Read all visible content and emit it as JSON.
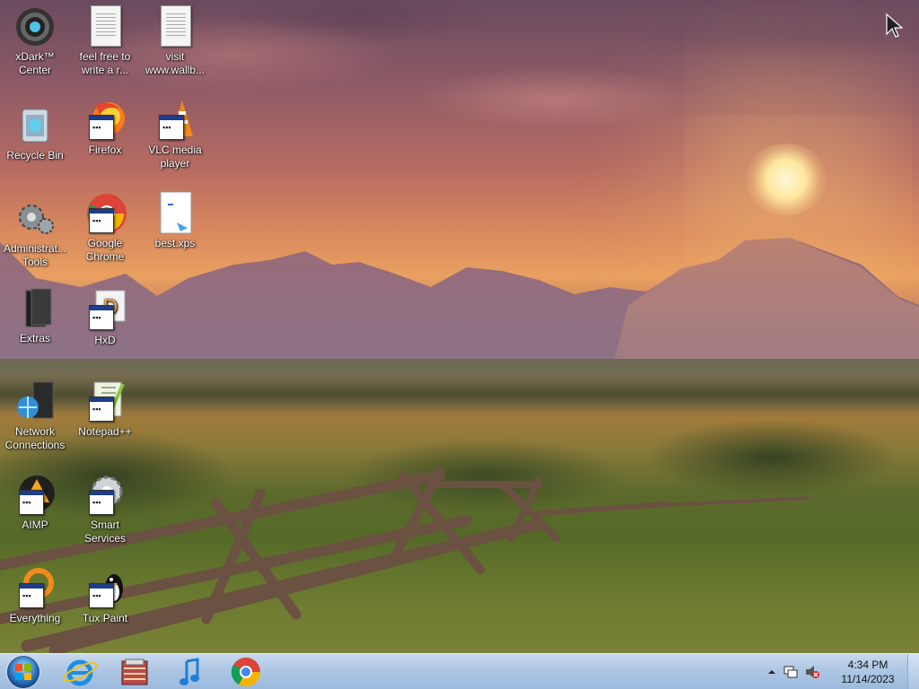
{
  "desktop": {
    "icons": [
      {
        "label": "xDark™ Center"
      },
      {
        "label": "feel free to write a r..."
      },
      {
        "label": "visit www.wallb..."
      },
      {
        "label": "Recycle Bin"
      },
      {
        "label": "Firefox"
      },
      {
        "label": "VLC media player"
      },
      {
        "label": "Administrat... Tools"
      },
      {
        "label": "Google Chrome"
      },
      {
        "label": "best.xps"
      },
      {
        "label": "Extras"
      },
      {
        "label": "HxD"
      },
      {
        "label": "Network Connections"
      },
      {
        "label": "Notepad++"
      },
      {
        "label": "AIMP"
      },
      {
        "label": "Smart Services"
      },
      {
        "label": "Everything"
      },
      {
        "label": "Tux Paint"
      }
    ]
  },
  "taskbar": {
    "pinned": [
      "start-button",
      "internet-explorer-icon",
      "archive-app-icon",
      "music-player-icon",
      "chrome-icon"
    ],
    "clock": {
      "time": "4:34 PM",
      "date": "11/14/2023"
    }
  },
  "colors": {
    "taskbar": "#aec7e4",
    "sky_top": "#6a4a5e",
    "sky_glow": "#e9a060",
    "grass": "#5c6a2c"
  }
}
